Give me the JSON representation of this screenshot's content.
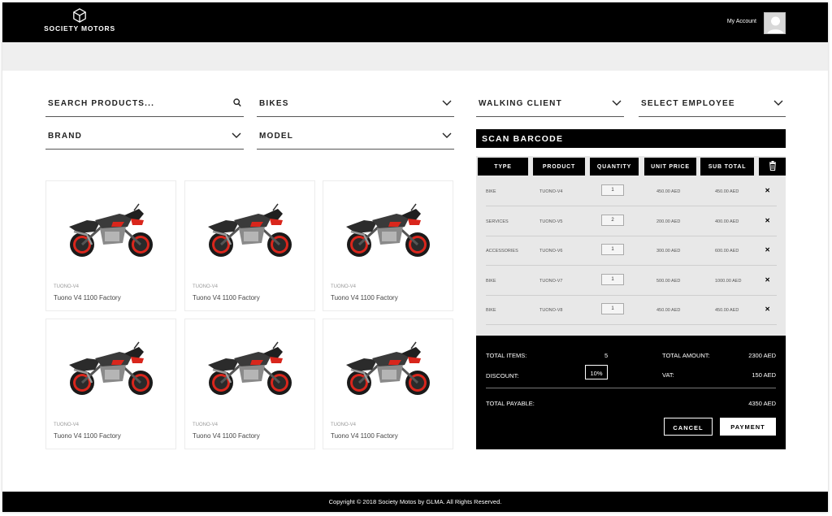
{
  "header": {
    "brand": "SOCIETY MOTORS",
    "account_label": "My Account"
  },
  "filters": {
    "search_placeholder": "SEARCH PRODUCTS...",
    "category": "BIKES",
    "brand": "BRAND",
    "model": "MODEL",
    "client": "WALKING CLIENT",
    "employee": "SELECT EMPLOYEE"
  },
  "products": [
    {
      "code": "TUONO-V4",
      "name": "Tuono V4 1100 Factory"
    },
    {
      "code": "TUONO-V4",
      "name": "Tuono V4 1100 Factory"
    },
    {
      "code": "TUONO-V4",
      "name": "Tuono V4 1100 Factory"
    },
    {
      "code": "TUONO-V4",
      "name": "Tuono V4 1100 Factory"
    },
    {
      "code": "TUONO-V4",
      "name": "Tuono V4 1100 Factory"
    },
    {
      "code": "TUONO-V4",
      "name": "Tuono V4 1100 Factory"
    }
  ],
  "cart": {
    "scan_label": "SCAN BARCODE",
    "headers": [
      "TYPE",
      "PRODUCT",
      "QUANTITY",
      "UNIT PRICE",
      "SUB TOTAL"
    ],
    "delete_icon": "trash-icon",
    "rows": [
      {
        "type": "BIKE",
        "product": "TUONO-V4",
        "qty": "1",
        "unit": "450.00 AED",
        "sub": "450.00 AED"
      },
      {
        "type": "SERVICES",
        "product": "TUONO-V5",
        "qty": "2",
        "unit": "200.00 AED",
        "sub": "400.00 AED"
      },
      {
        "type": "ACCESSORIES",
        "product": "TUONO-V6",
        "qty": "1",
        "unit": "300.00 AED",
        "sub": "600.00 AED"
      },
      {
        "type": "BIKE",
        "product": "TUONO-V7",
        "qty": "1",
        "unit": "500.00 AED",
        "sub": "1000.00 AED"
      },
      {
        "type": "BIKE",
        "product": "TUONO-V8",
        "qty": "1",
        "unit": "450.00 AED",
        "sub": "450.00 AED"
      }
    ]
  },
  "summary": {
    "total_items_label": "TOTAL ITEMS:",
    "total_items": "5",
    "total_amount_label": "TOTAL AMOUNT:",
    "total_amount": "2300 AED",
    "discount_label": "DISCOUNT:",
    "discount": "10%",
    "vat_label": "VAT:",
    "vat": "150 AED",
    "payable_label": "TOTAL PAYABLE:",
    "payable": "4350 AED",
    "cancel_label": "CANCEL",
    "payment_label": "PAYMENT"
  },
  "footer": {
    "copyright": "Copyright © 2018 Society Motos by GLMA. All Rights Reserved."
  },
  "colors": {
    "black": "#000000",
    "light_gray": "#efefef",
    "cart_gray": "#e8e8e8",
    "bike_red": "#d9261c"
  }
}
